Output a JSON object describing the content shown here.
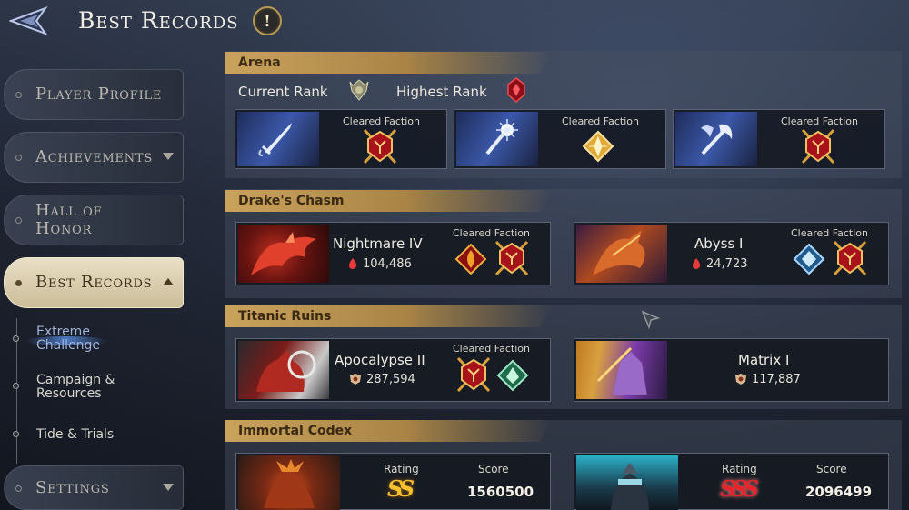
{
  "header": {
    "title": "Best Records",
    "info_symbol": "!"
  },
  "sidebar": {
    "items": [
      {
        "label": "Player Profile"
      },
      {
        "label": "Achievements"
      },
      {
        "label": "Hall of Honor"
      },
      {
        "label": "Best Records"
      },
      {
        "label": "Settings"
      }
    ],
    "sub_items": [
      {
        "label": "Extreme Challenge"
      },
      {
        "label": "Campaign & Resources"
      },
      {
        "label": "Tide & Trials"
      }
    ]
  },
  "arena": {
    "title": "Arena",
    "current_rank_label": "Current Rank",
    "highest_rank_label": "Highest Rank",
    "cards": [
      {
        "label": "Cleared Faction",
        "weapon_icon": "sword-icon",
        "badge": "red-faction-badge"
      },
      {
        "label": "Cleared Faction",
        "weapon_icon": "staff-icon",
        "badge": "gold-faction-badge"
      },
      {
        "label": "Cleared Faction",
        "weapon_icon": "axe-icon",
        "badge": "red-faction-badge"
      }
    ]
  },
  "drakes_chasm": {
    "title": "Drake's Chasm",
    "cards": [
      {
        "name": "Nightmare IV",
        "score": "104,486",
        "label": "Cleared Faction"
      },
      {
        "name": "Abyss I",
        "score": "24,723",
        "label": "Cleared Faction"
      }
    ]
  },
  "titanic_ruins": {
    "title": "Titanic Ruins",
    "cards": [
      {
        "name": "Apocalypse II",
        "score": "287,594",
        "label": "Cleared Faction"
      },
      {
        "name": "Matrix I",
        "score": "117,887"
      }
    ]
  },
  "immortal_codex": {
    "title": "Immortal Codex",
    "cards": [
      {
        "rating_label": "Rating",
        "rating": "SS",
        "score_label": "Score",
        "score": "1560500"
      },
      {
        "rating_label": "Rating",
        "rating": "SSS",
        "score_label": "Score",
        "score": "2096499"
      }
    ]
  },
  "colors": {
    "gold_header": "#c9a35c",
    "active_tab": "#e9dfc6",
    "faction_red": "#b3121b",
    "faction_gold": "#e0a93a"
  }
}
